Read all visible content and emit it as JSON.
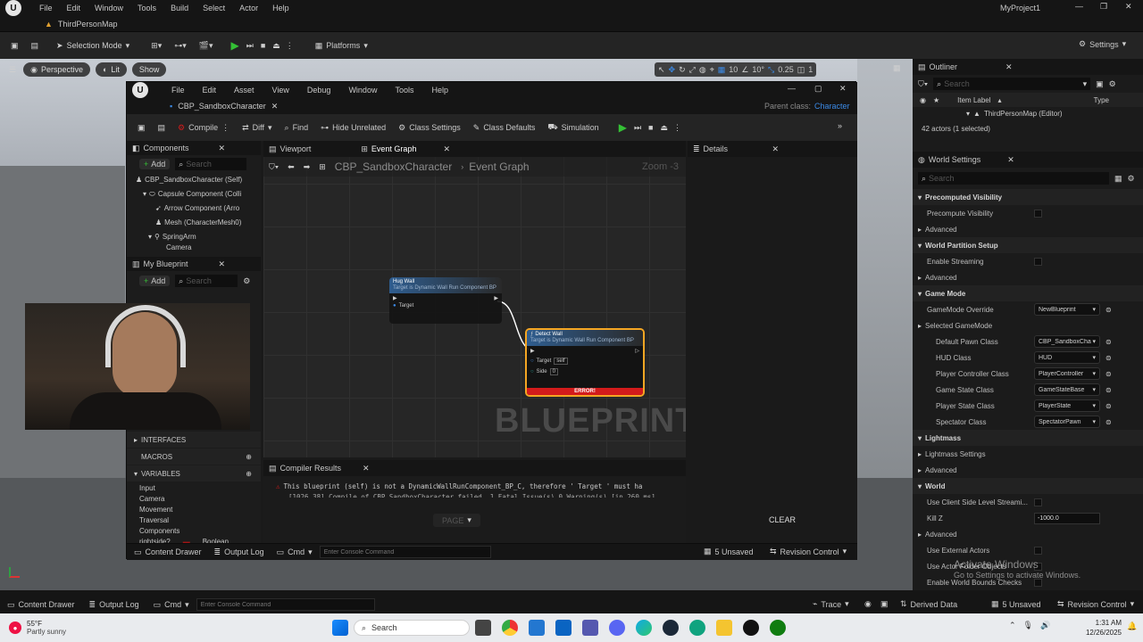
{
  "app": {
    "menu": [
      "File",
      "Edit",
      "Window",
      "Tools",
      "Build",
      "Select",
      "Actor",
      "Help"
    ],
    "project": "MyProject1",
    "map_tab": "ThirdPersonMap",
    "selection_mode": "Selection Mode",
    "platforms": "Platforms",
    "settings": "Settings"
  },
  "viewport": {
    "perspective": "Perspective",
    "lit": "Lit",
    "show": "Show",
    "grid_snap": "10",
    "rot_snap": "10°",
    "scale_snap": "0.25",
    "cam_speed": "1"
  },
  "blueprint": {
    "menu": [
      "File",
      "Edit",
      "Asset",
      "View",
      "Debug",
      "Window",
      "Tools",
      "Help"
    ],
    "tab": "CBP_SandboxCharacter",
    "parent_class_label": "Parent class:",
    "parent_class": "Character",
    "toolbar": {
      "compile": "Compile",
      "diff": "Diff",
      "find": "Find",
      "hide_unrelated": "Hide Unrelated",
      "class_settings": "Class Settings",
      "class_defaults": "Class Defaults",
      "simulation": "Simulation"
    },
    "components": {
      "title": "Components",
      "add": "Add",
      "search": "Search",
      "tree": [
        "CBP_SandboxCharacter (Self)",
        "Capsule Component (Colli",
        "Arrow Component (Arro",
        "Mesh (CharacterMesh0)",
        "SpringArm",
        "Camera"
      ]
    },
    "my_blueprint": {
      "title": "My Blueprint",
      "add": "Add",
      "search": "Search",
      "sections": [
        "INTERFACES",
        "MACROS",
        "VARIABLES"
      ],
      "variables": [
        "Input",
        "Camera",
        "Movement",
        "Traversal",
        "Components"
      ],
      "last_var": "rightside?",
      "last_type": "Boolean"
    },
    "graph_tabs": {
      "viewport": "Viewport",
      "event_graph": "Event Graph"
    },
    "breadcrumb": {
      "class": "CBP_SandboxCharacter",
      "graph": "Event Graph"
    },
    "zoom": "Zoom -3",
    "watermark": "BLUEPRINT",
    "node_left": {
      "title": "Hug Wall",
      "subtitle": "Target is Dynamic Wall Run Component BP",
      "pin": "Target"
    },
    "node_main": {
      "title": "Detect Wall",
      "subtitle": "Target is Dynamic Wall Run Component BP",
      "pin_target": "Target",
      "pin_target_value": "self",
      "pin_side": "Side",
      "pin_side_value": "0",
      "error": "ERROR!"
    },
    "details": {
      "title": "Details"
    },
    "compiler": {
      "title": "Compiler Results",
      "line1": "This blueprint (self) is not a DynamicWallRunComponent_BP_C, therefore ' Target ' must ha",
      "line2": "[1026.38] Compile of CBP_SandboxCharacter failed. 1 Fatal Issue(s) 0 Warning(s) [in 260 ms]",
      "page": "PAGE",
      "clear": "CLEAR"
    },
    "status": {
      "content_drawer": "Content Drawer",
      "output_log": "Output Log",
      "cmd": "Cmd",
      "console_placeholder": "Enter Console Command",
      "unsaved": "5 Unsaved",
      "revision": "Revision Control"
    }
  },
  "outliner": {
    "title": "Outliner",
    "search": "Search",
    "col_label": "Item Label",
    "col_type": "Type",
    "row": "ThirdPersonMap (Editor)",
    "count": "42 actors (1 selected)"
  },
  "world_settings": {
    "title": "World Settings",
    "search": "Search",
    "props": [
      {
        "label": "Precomputed Visibility",
        "kind": "section"
      },
      {
        "label": "Precompute Visibility",
        "kind": "check"
      },
      {
        "label": "Advanced",
        "kind": "sub"
      },
      {
        "label": "World Partition Setup",
        "kind": "section"
      },
      {
        "label": "Enable Streaming",
        "kind": "check"
      },
      {
        "label": "Advanced",
        "kind": "sub"
      },
      {
        "label": "Game Mode",
        "kind": "section"
      },
      {
        "label": "GameMode Override",
        "kind": "drop",
        "value": "NewBlueprint"
      },
      {
        "label": "Selected GameMode",
        "kind": "sub"
      },
      {
        "label": "Default Pawn Class",
        "kind": "drop2",
        "value": "CBP_SandboxCha"
      },
      {
        "label": "HUD Class",
        "kind": "drop2",
        "value": "HUD"
      },
      {
        "label": "Player Controller Class",
        "kind": "drop2",
        "value": "PlayerController"
      },
      {
        "label": "Game State Class",
        "kind": "drop2",
        "value": "GameStateBase"
      },
      {
        "label": "Player State Class",
        "kind": "drop2",
        "value": "PlayerState"
      },
      {
        "label": "Spectator Class",
        "kind": "drop2",
        "value": "SpectatorPawn"
      },
      {
        "label": "Lightmass",
        "kind": "section"
      },
      {
        "label": "Lightmass Settings",
        "kind": "sub"
      },
      {
        "label": "Advanced",
        "kind": "sub"
      },
      {
        "label": "World",
        "kind": "section"
      },
      {
        "label": "Use Client Side Level Streami...",
        "kind": "check"
      },
      {
        "label": "Kill Z",
        "kind": "num",
        "value": "-1000.0"
      },
      {
        "label": "Advanced",
        "kind": "sub"
      },
      {
        "label": "Use External Actors",
        "kind": "check"
      },
      {
        "label": "Use Actor Folder Objects",
        "kind": "check"
      },
      {
        "label": "Enable World Bounds Checks",
        "kind": "check"
      }
    ],
    "activate_title": "Activate Windows",
    "activate_sub": "Go to Settings to activate Windows."
  },
  "statusbar": {
    "content_drawer": "Content Drawer",
    "output_log": "Output Log",
    "cmd": "Cmd",
    "console_placeholder": "Enter Console Command",
    "trace": "Trace",
    "derived_data": "Derived Data",
    "unsaved": "5 Unsaved",
    "revision": "Revision Control"
  },
  "taskbar": {
    "weather_temp": "55°F",
    "weather_desc": "Partly sunny",
    "search": "Search",
    "time": "1:31 AM",
    "date": "12/26/2025"
  },
  "colors": {
    "accent_blue": "#3b8ae6",
    "play_green": "#34c035",
    "error_red": "#d31b1b",
    "node_select": "#f5a623"
  }
}
